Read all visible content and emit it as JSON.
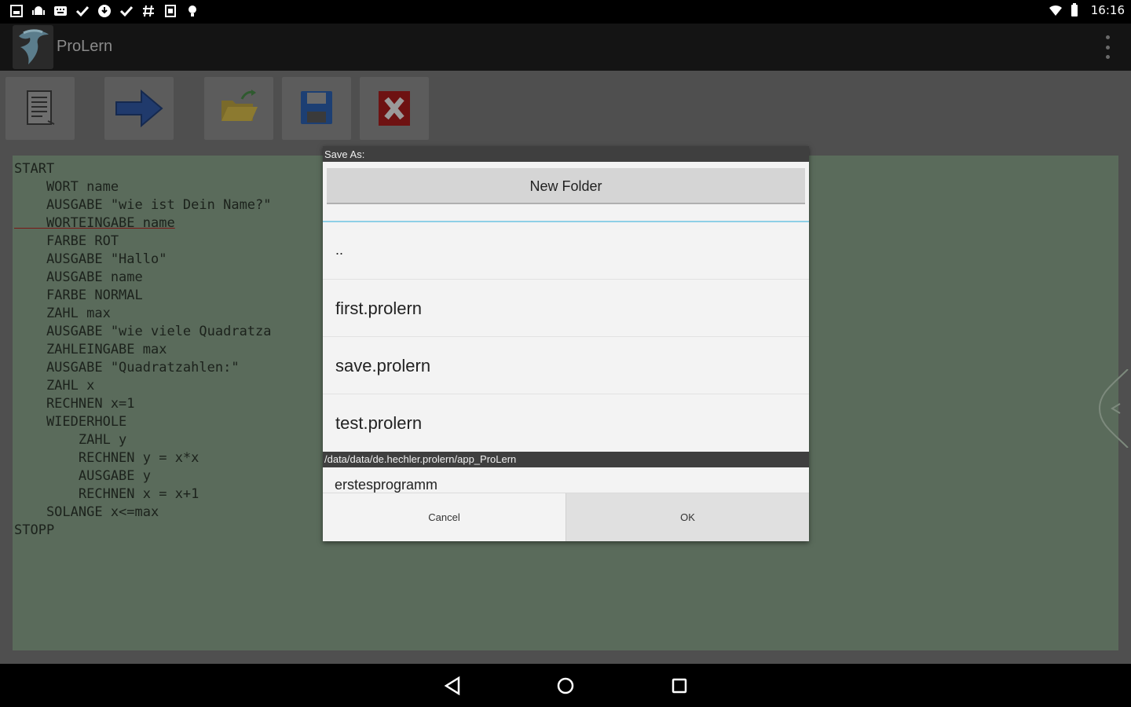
{
  "status_bar": {
    "time": "16:16",
    "left_icons": [
      "gallery-icon",
      "android-icon",
      "keyboard-icon",
      "check-icon",
      "download-icon",
      "check-icon",
      "hash-icon",
      "battery-saver-icon",
      "lightbulb-icon"
    ],
    "right_icons": [
      "wifi-icon",
      "battery-icon"
    ]
  },
  "action_bar": {
    "title": "ProLern"
  },
  "toolbar": {
    "buttons": [
      "new-file",
      "run",
      "open",
      "save",
      "close"
    ]
  },
  "editor": {
    "lines": [
      "START",
      "    WORT name",
      "    AUSGABE \"wie ist Dein Name?\"",
      "    WORTEINGABE name",
      "    FARBE ROT",
      "    AUSGABE \"Hallo\"",
      "    AUSGABE name",
      "    FARBE NORMAL",
      "    ZAHL max",
      "    AUSGABE \"wie viele Quadratza",
      "    ZAHLEINGABE max",
      "    AUSGABE \"Quadratzahlen:\"",
      "    ZAHL x",
      "    RECHNEN x=1",
      "    WIEDERHOLE",
      "        ZAHL y",
      "        RECHNEN y = x*x",
      "        AUSGABE y",
      "        RECHNEN x = x+1",
      "    SOLANGE x<=max",
      "STOPP"
    ]
  },
  "dialog": {
    "title": "Save As:",
    "new_folder_label": "New Folder",
    "files": [
      "..",
      "first.prolern",
      "save.prolern",
      "test.prolern"
    ],
    "path": "/data/data/de.hechler.prolern/app_ProLern",
    "filename_value": "erstesprogramm",
    "cancel_label": "Cancel",
    "ok_label": "OK"
  },
  "colors": {
    "accent_underline": "#8ecfe6",
    "editor_bg_dimmed": "#5a6b5b",
    "dialog_bg": "#f3f3f3"
  }
}
